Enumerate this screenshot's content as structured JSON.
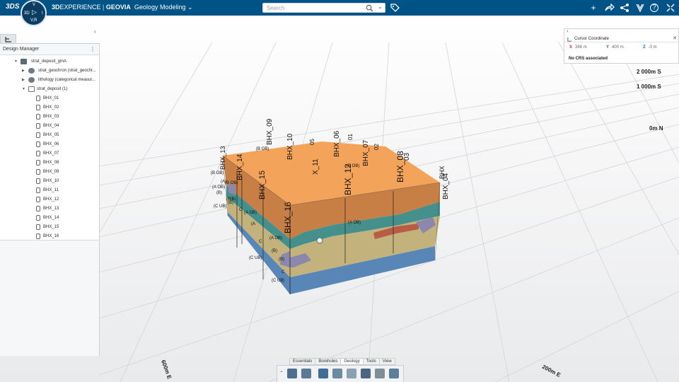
{
  "header": {
    "brand_logo": "3DS",
    "app_prefix": "3D",
    "app_experience": "EXPERIENCE",
    "app_separator": " | ",
    "app_brand": "GEOVIA",
    "app_name": "Geology Modeling",
    "compass": {
      "top": "V",
      "left": "3D",
      "right": "I",
      "bottom": "V,R"
    },
    "search": {
      "placeholder": "Search",
      "value": ""
    }
  },
  "design_manager": {
    "title": "Design Manager",
    "tree": [
      {
        "label": "strat_deposit_gmA",
        "indent": 0,
        "expanded": true,
        "icon": "cube-icon"
      },
      {
        "label": "strat_geochron (strat_geochr...",
        "indent": 1,
        "expanded": false,
        "icon": "sphere-icon"
      },
      {
        "label": "lithology (categorical measur...",
        "indent": 1,
        "expanded": false,
        "icon": "sphere-icon"
      },
      {
        "label": "strat_deposit (1)",
        "indent": 1,
        "expanded": true,
        "icon": "document-icon"
      }
    ],
    "boreholes": [
      "BHX_01",
      "BHX_02",
      "BHX_03",
      "BHX_04",
      "BHX_05",
      "BHX_06",
      "BHX_07",
      "BHX_08",
      "BHX_09",
      "BHX_10",
      "BHX_11",
      "BHX_12",
      "BHX_13",
      "BHX_14",
      "BHX_15",
      "BHX_16"
    ]
  },
  "cursor_coordinate": {
    "title": "Cursor Coordinate",
    "x_label": "X",
    "x_value": "386 m",
    "y_label": "Y",
    "y_value": "400 m",
    "z_label": "Z",
    "z_value": "-3 m",
    "crs": "No CRS associated"
  },
  "viewport": {
    "scale_labels": [
      "2 000m S",
      "1 000m S",
      "0m N"
    ],
    "axis_labels": [
      "600m E",
      "200m E"
    ],
    "model_labels_top": [
      "BHX_09",
      "BHX_10",
      "05",
      "BHX_06",
      "01",
      "BHX_07",
      "02",
      "03",
      "BHX_04",
      "BHX_13",
      "BHX_14",
      "X_11"
    ],
    "model_labels_front": [
      "BHX_15",
      "BHX_16",
      "BHX_12",
      "BHX_08",
      "BHX"
    ],
    "layer_tags": [
      "(B OB)",
      "(B OB)",
      "(A OB)",
      "(A OB)",
      "(B OB)",
      "(A OB)",
      "(B OB)",
      "(C UB)",
      "(C UB)",
      "(C UB)",
      "(B|B)",
      "(A OB)",
      "(B)",
      "(A)",
      "C",
      "C",
      "C",
      "(B)",
      "(B)",
      "(B)",
      "(A"
    ]
  },
  "toolbar": {
    "tabs": [
      "Essentials",
      "Boreholes",
      "Geology",
      "Tools",
      "View"
    ],
    "active_tab": "Geology",
    "buttons": [
      "geology-model-icon",
      "volume-icon",
      "surface-icon",
      "block-icon",
      "section-icon",
      "solid-icon",
      "table-icon",
      "inspect-icon"
    ]
  },
  "colors": {
    "topbar": "#005386",
    "layer_top": "#f4a45a",
    "layer_upper": "#c77f45",
    "layer_teal": "#45908d",
    "layer_tan": "#c3b27c",
    "layer_blue": "#5786b7",
    "layer_purple": "#8c87ad",
    "layer_red": "#b95c45"
  }
}
